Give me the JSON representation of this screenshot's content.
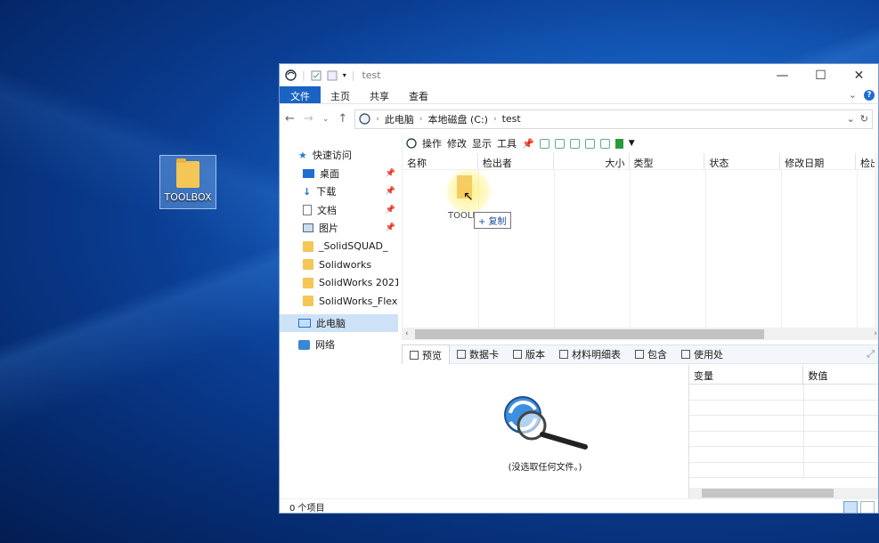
{
  "desktop": {
    "icon_label": "TOOLBOX"
  },
  "window": {
    "title": "test",
    "controls": {
      "minimize": "—",
      "maximize": "☐",
      "close": "✕"
    }
  },
  "ribbon": {
    "tabs": [
      {
        "label": "文件",
        "active": true
      },
      {
        "label": "主页"
      },
      {
        "label": "共享"
      },
      {
        "label": "查看"
      }
    ]
  },
  "address": {
    "back": "←",
    "forward": "→",
    "recent": "⌄",
    "up": "↑",
    "segments": [
      "此电脑",
      "本地磁盘 (C:)",
      "test"
    ],
    "separator": "›"
  },
  "sidebar": {
    "quick_access": "快速访问",
    "items": [
      {
        "label": "桌面",
        "pinned": true,
        "icon": "desktop-icon"
      },
      {
        "label": "下载",
        "pinned": true,
        "icon": "download-icon"
      },
      {
        "label": "文档",
        "pinned": true,
        "icon": "document-icon"
      },
      {
        "label": "图片",
        "pinned": true,
        "icon": "picture-icon"
      },
      {
        "label": "_SolidSQUAD_",
        "icon": "folder-icon"
      },
      {
        "label": "Solidworks",
        "icon": "folder-icon"
      },
      {
        "label": "SolidWorks 2021",
        "icon": "folder-icon"
      },
      {
        "label": "SolidWorks_Flexnet",
        "icon": "folder-icon"
      }
    ],
    "this_pc": "此电脑",
    "network": "网络"
  },
  "sw_toolbar": {
    "items": [
      "操作",
      "修改",
      "显示",
      "工具"
    ]
  },
  "columns": [
    "名称",
    "检出者",
    "大小",
    "类型",
    "状态",
    "修改日期",
    "检出"
  ],
  "drag": {
    "label": "TOOLBOX",
    "tooltip": "+ 复制"
  },
  "bottom_tabs": [
    {
      "label": "预览",
      "active": true
    },
    {
      "label": "数据卡"
    },
    {
      "label": "版本"
    },
    {
      "label": "材料明细表"
    },
    {
      "label": "包含"
    },
    {
      "label": "使用处"
    }
  ],
  "preview": {
    "caption": "(没选取任何文件。)"
  },
  "variables": {
    "headers": [
      "变量",
      "数值"
    ]
  },
  "status": {
    "count": "0 个项目"
  }
}
